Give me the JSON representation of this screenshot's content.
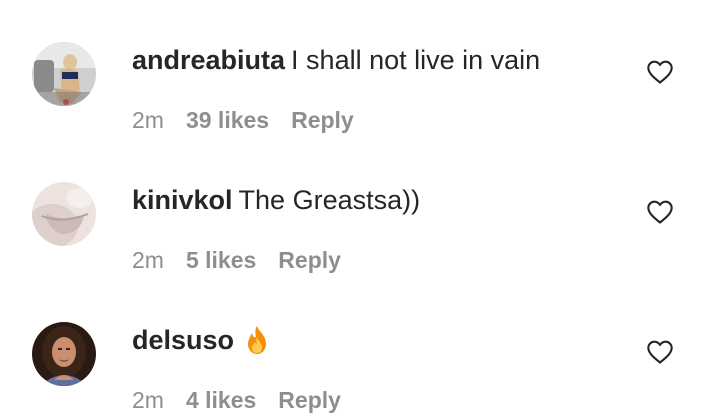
{
  "comments": [
    {
      "username": "andreabiuta",
      "text": "I shall not live in vain",
      "emoji": "",
      "time": "2m",
      "likes": "39 likes",
      "reply": "Reply",
      "avatar_icon": "user-avatar-photo"
    },
    {
      "username": "kinivkol",
      "text": "The Greastsa))",
      "emoji": "",
      "time": "2m",
      "likes": "5 likes",
      "reply": "Reply",
      "avatar_icon": "user-avatar-photo"
    },
    {
      "username": "delsuso",
      "text": "",
      "emoji": "fire-emoji",
      "time": "2m",
      "likes": "4 likes",
      "reply": "Reply",
      "avatar_icon": "user-avatar-photo"
    }
  ],
  "colors": {
    "text": "#262626",
    "meta": "#8e8e8e",
    "heart_outline": "#262626",
    "fire_outer": "#f4900c",
    "fire_inner": "#ffcc4d"
  }
}
